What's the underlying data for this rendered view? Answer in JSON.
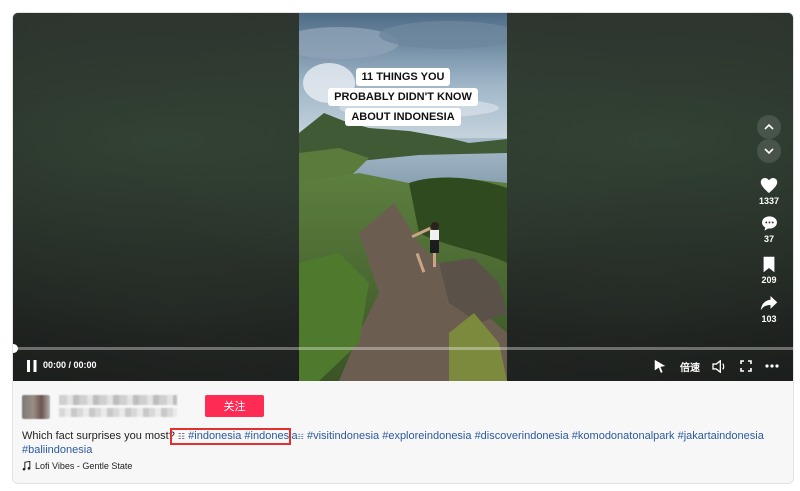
{
  "video": {
    "overlay_title": [
      "11 THINGS YOU",
      "PROBABLY DIDN'T KNOW",
      "ABOUT INDONESIA"
    ],
    "time": "00:00 / 00:00",
    "progress": 0,
    "speed_label": "倍速"
  },
  "actions": {
    "likes": "1337",
    "comments": "37",
    "saves": "209",
    "shares": "103"
  },
  "author": {
    "follow_label": "关注"
  },
  "post": {
    "description": "Which fact surprises you most?",
    "inline_mark": "☷",
    "hashtags": [
      "#indonesia",
      "#indonesia",
      "#visitindonesia",
      "#exploreindonesia",
      "#discoverindonesia",
      "#komodonatonalpark",
      "#jakartaindonesia",
      "#baliindonesia"
    ],
    "music": "Lofi Vibes - Gentle State"
  },
  "colors": {
    "accent": "#fe2c55",
    "hashtag": "#2b5a9e",
    "highlight_box": "#e0312f"
  }
}
